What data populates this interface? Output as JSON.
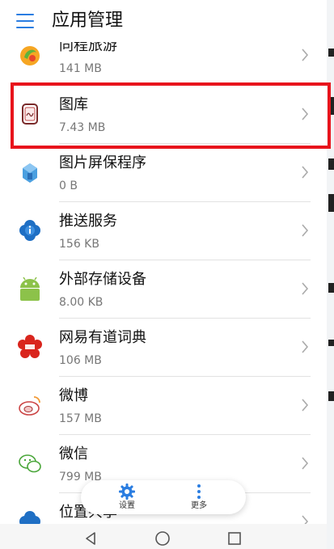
{
  "header": {
    "title": "应用管理",
    "menu_icon": "menu-icon"
  },
  "apps": [
    {
      "name": "同程旅游",
      "size": "141 MB",
      "icon": "tongcheng-travel-icon"
    },
    {
      "name": "图库",
      "size": "7.43 MB",
      "icon": "gallery-icon",
      "highlighted": true
    },
    {
      "name": "图片屏保程序",
      "size": "0 B",
      "icon": "screensaver-icon"
    },
    {
      "name": "推送服务",
      "size": "156 KB",
      "icon": "push-service-icon"
    },
    {
      "name": "外部存储设备",
      "size": "8.00 KB",
      "icon": "android-icon"
    },
    {
      "name": "网易有道词典",
      "size": "106 MB",
      "icon": "youdao-dict-icon"
    },
    {
      "name": "微博",
      "size": "157 MB",
      "icon": "weibo-icon"
    },
    {
      "name": "微信",
      "size": "799 MB",
      "icon": "wechat-icon"
    },
    {
      "name": "位置共享",
      "size": "",
      "icon": "location-share-icon"
    }
  ],
  "fab": {
    "settings_label": "设置",
    "settings_icon": "gear-icon",
    "more_label": "更多",
    "more_icon": "more-vertical-icon"
  },
  "navbar": {
    "back_icon": "back-icon",
    "home_icon": "home-icon",
    "recents_icon": "recents-icon"
  },
  "colors": {
    "accent": "#2a7de1",
    "highlight_box": "#e8141c"
  }
}
